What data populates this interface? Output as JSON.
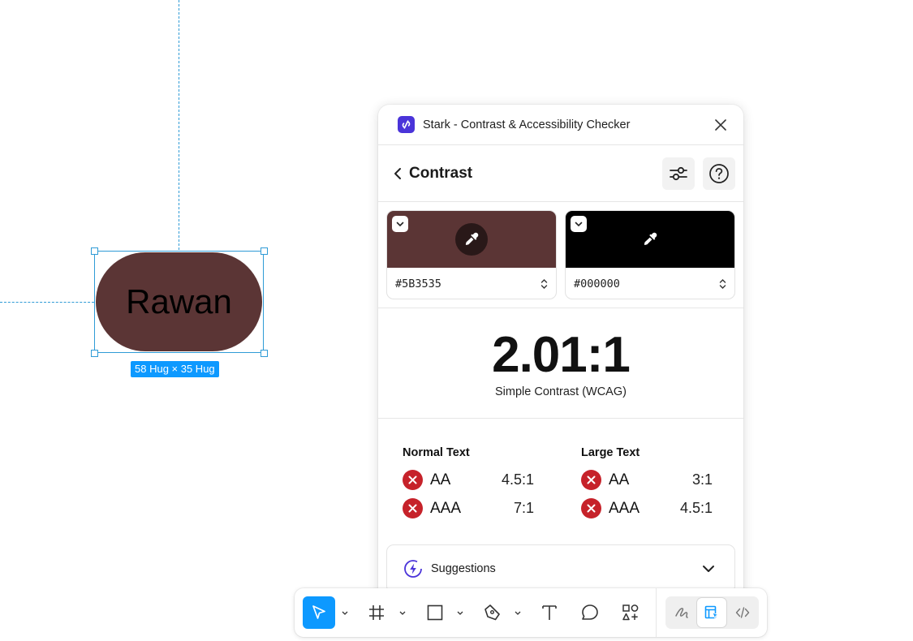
{
  "canvas": {
    "element_text": "Rawan",
    "element_fill": "#5B3535",
    "size_label": "58 Hug × 35 Hug",
    "selection_color": "#2f9bd6"
  },
  "plugin": {
    "title": "Stark - Contrast & Accessibility Checker",
    "logo_color": "#4a34d9",
    "section_title": "Contrast",
    "foreground": {
      "hex": "#5B3535",
      "color": "#5B3535"
    },
    "background": {
      "hex": "#000000",
      "color": "#000000"
    },
    "ratio": "2.01:1",
    "ratio_caption": "Simple Contrast (WCAG)",
    "normal_text": {
      "title": "Normal Text",
      "rows": [
        {
          "level": "AA",
          "requirement": "4.5:1",
          "status": "fail"
        },
        {
          "level": "AAA",
          "requirement": "7:1",
          "status": "fail"
        }
      ]
    },
    "large_text": {
      "title": "Large Text",
      "rows": [
        {
          "level": "AA",
          "requirement": "3:1",
          "status": "fail"
        },
        {
          "level": "AAA",
          "requirement": "4.5:1",
          "status": "fail"
        }
      ]
    },
    "fail_color": "#c6222a",
    "suggestions_label": "Suggestions"
  },
  "toolbar": {
    "accent": "#0d99ff",
    "tools": [
      "move-tool",
      "frame-tool",
      "rectangle-tool",
      "pen-tool",
      "text-tool",
      "comment-tool",
      "actions-tool"
    ],
    "modes": [
      "draw-mode",
      "design-mode",
      "dev-mode"
    ],
    "active_mode": "design-mode"
  }
}
